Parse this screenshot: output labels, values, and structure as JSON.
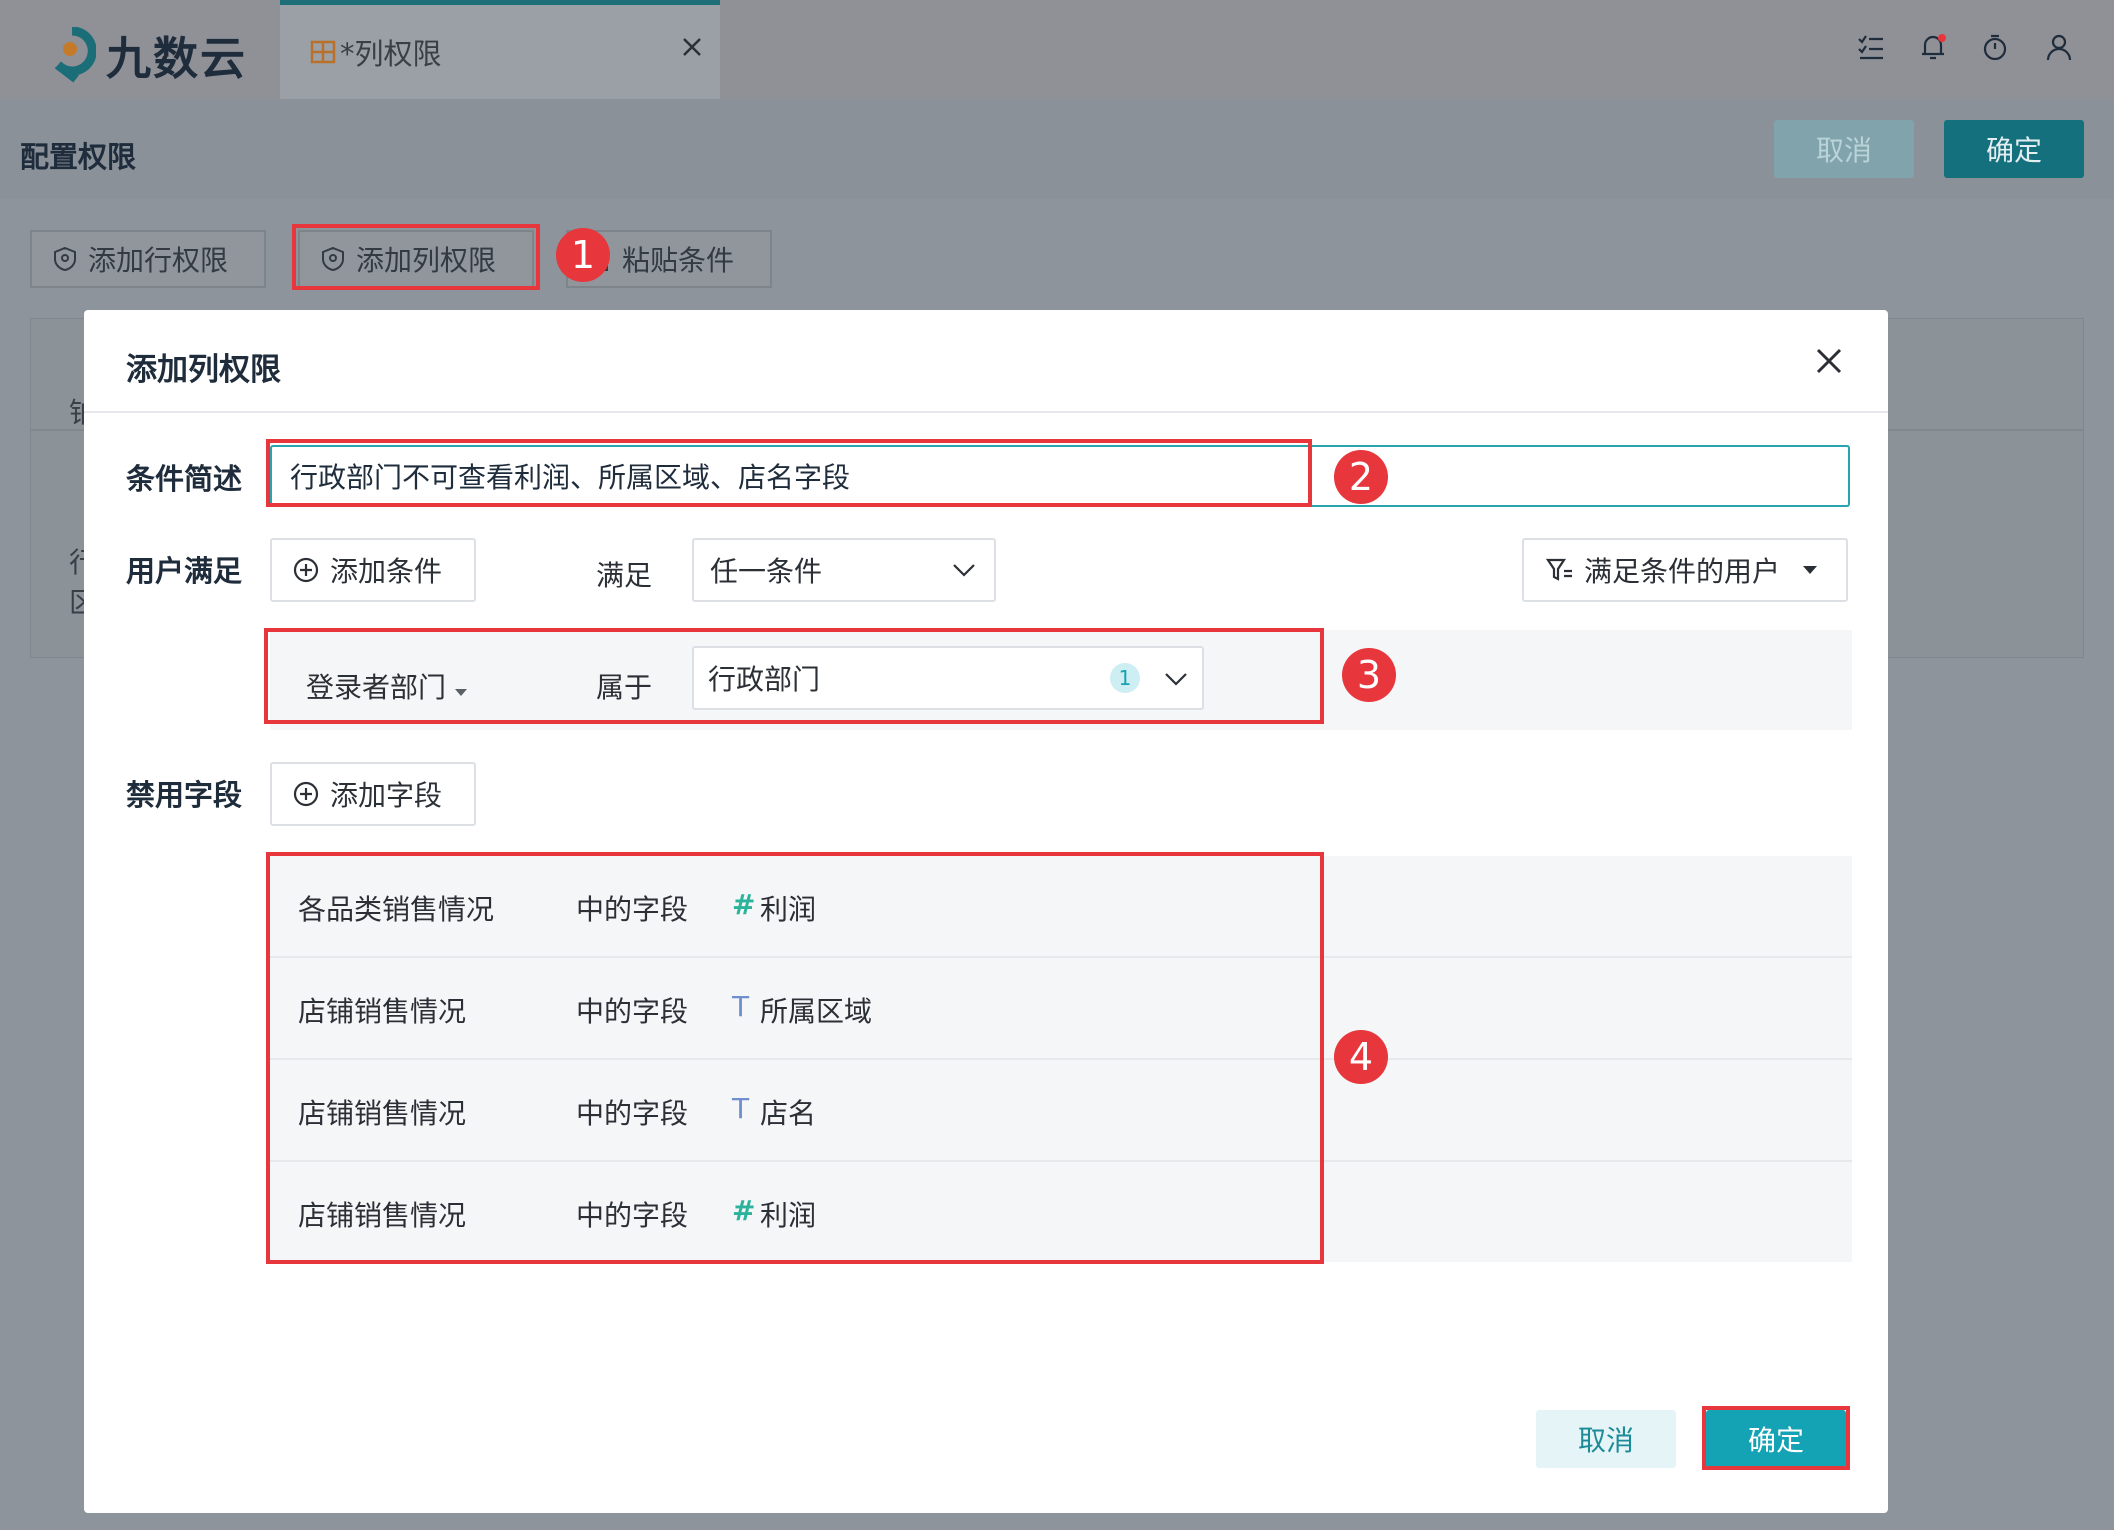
{
  "app": {
    "logo_text": "九数云"
  },
  "tab": {
    "label": "*列权限"
  },
  "config": {
    "title": "配置权限",
    "cancel_label": "取消",
    "ok_label": "确定",
    "add_row_perm_label": "添加行权限",
    "add_col_perm_label": "添加列权限",
    "paste_cond_label": "粘贴条件",
    "bg_row1_fragment": "铂",
    "bg_row2_fragment_a": "行",
    "bg_row2_fragment_b": "区"
  },
  "dialog": {
    "title": "添加列权限",
    "desc_label": "条件简述",
    "desc_value": "行政部门不可查看利润、所属区域、店名字段",
    "user_label": "用户满足",
    "add_condition_label": "添加条件",
    "satisfy_label": "满足",
    "satisfy_value": "任一条件",
    "filter_users_label": "满足条件的用户",
    "condition": {
      "field": "登录者部门",
      "operator": "属于",
      "value": "行政部门",
      "count": "1"
    },
    "forbid_label": "禁用字段",
    "add_field_label": "添加字段",
    "fields": [
      {
        "table": "各品类销售情况",
        "mid": "中的字段",
        "type": "number",
        "type_symbol": "#",
        "name": "利润"
      },
      {
        "table": "店铺销售情况",
        "mid": "中的字段",
        "type": "text",
        "type_symbol": "T",
        "name": "所属区域"
      },
      {
        "table": "店铺销售情况",
        "mid": "中的字段",
        "type": "text",
        "type_symbol": "T",
        "name": "店名"
      },
      {
        "table": "店铺销售情况",
        "mid": "中的字段",
        "type": "number",
        "type_symbol": "#",
        "name": "利润"
      }
    ],
    "cancel_label": "取消",
    "ok_label": "确定"
  },
  "annotations": [
    "1",
    "2",
    "3",
    "4"
  ],
  "colors": {
    "accent": "#14a2b5",
    "annotation_red": "#e7363c",
    "number_type": "#2bb39c",
    "text_type": "#6f8fcf"
  }
}
